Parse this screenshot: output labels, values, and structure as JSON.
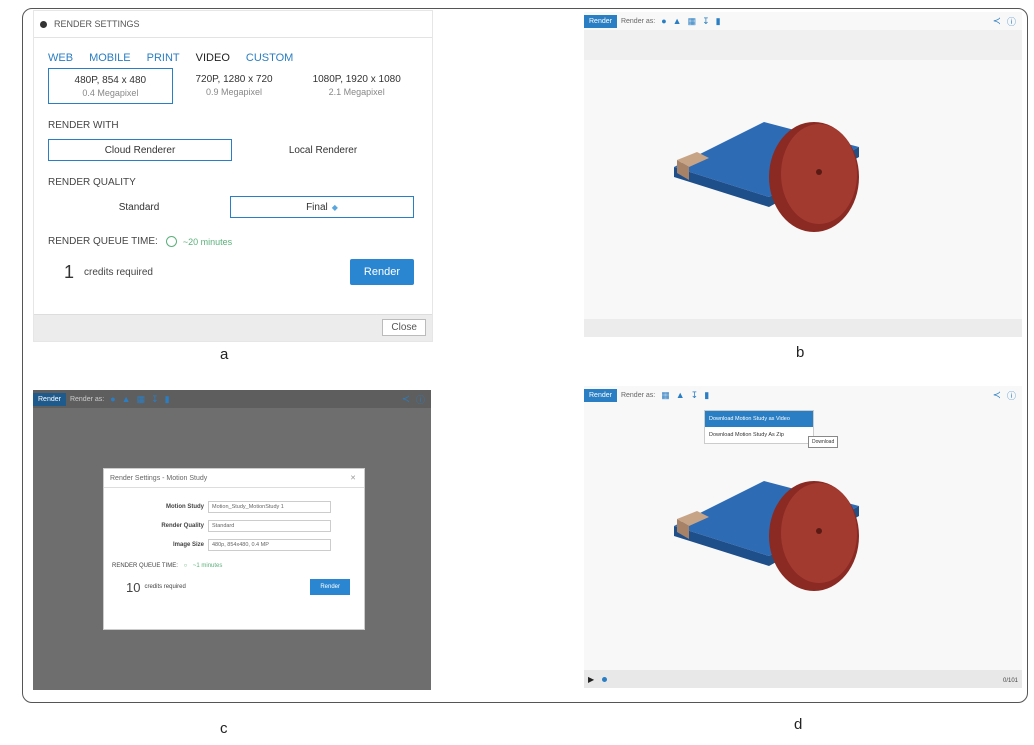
{
  "captions": {
    "a": "a",
    "b": "b",
    "c": "c",
    "d": "d"
  },
  "panel_a": {
    "title": "RENDER SETTINGS",
    "tabs": [
      "WEB",
      "MOBILE",
      "PRINT",
      "VIDEO",
      "CUSTOM"
    ],
    "active_tab": "VIDEO",
    "resolutions": [
      {
        "label": "480P, 854 x 480",
        "sub": "0.4 Megapixel"
      },
      {
        "label": "720P, 1280 x 720",
        "sub": "0.9 Megapixel"
      },
      {
        "label": "1080P, 1920 x 1080",
        "sub": "2.1 Megapixel"
      }
    ],
    "render_with_label": "RENDER WITH",
    "renderers": [
      "Cloud Renderer",
      "Local Renderer"
    ],
    "quality_label": "RENDER QUALITY",
    "qualities": [
      "Standard",
      "Final"
    ],
    "queue_label": "RENDER QUEUE TIME:",
    "queue_time": "~20 minutes",
    "credits_num": "1",
    "credits_label": "credits required",
    "render_button": "Render",
    "close_button": "Close"
  },
  "viewer": {
    "render_button": "Render",
    "render_as": "Render as:"
  },
  "panel_c": {
    "dialog_title": "Render Settings - Motion Study",
    "fields": [
      {
        "label": "Motion Study",
        "value": "Motion_Study_MotionStudy 1"
      },
      {
        "label": "Render Quality",
        "value": "Standard"
      },
      {
        "label": "Image Size",
        "value": "480p, 854x480, 0.4 MP"
      }
    ],
    "queue_label": "RENDER QUEUE TIME:",
    "queue_time": "~1 minutes",
    "credits_num": "10",
    "credits_label": "credits required",
    "render_button": "Render"
  },
  "panel_d": {
    "menu_items": [
      "Download Motion Study as Video",
      "Download Motion Study As Zip"
    ],
    "tooltip": "Download",
    "frame_counter": "0/101"
  },
  "colors": {
    "accent": "#2a7ec3",
    "plate": "#2d6bb5",
    "wheel": "#8a2a22",
    "block": "#c8a487"
  }
}
